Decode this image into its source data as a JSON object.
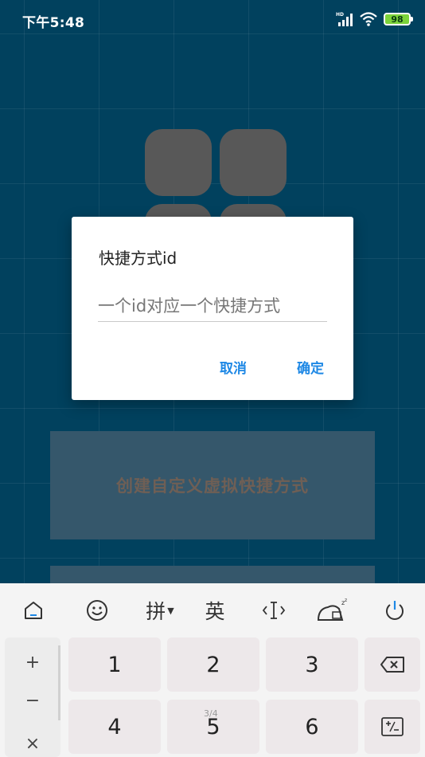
{
  "status_bar": {
    "time": "下午5:48",
    "battery": "98",
    "network": "HD"
  },
  "background": {
    "action_card_label": "创建自定义虚拟快捷方式"
  },
  "dialog": {
    "title": "快捷方式id",
    "input_placeholder": "一个id对应一个快捷方式",
    "input_value": "",
    "cancel_label": "取消",
    "ok_label": "确定"
  },
  "keyboard": {
    "toolbar": {
      "pinyin_label": "拼",
      "english_label": "英"
    },
    "side_keys": [
      "+",
      "−",
      "×"
    ],
    "keys": [
      "1",
      "2",
      "3",
      "4",
      "5",
      "6"
    ],
    "page_indicator": "3/4"
  },
  "colors": {
    "background": "#01415e",
    "accent": "#1e88e5",
    "battery": "#7cd33a"
  }
}
